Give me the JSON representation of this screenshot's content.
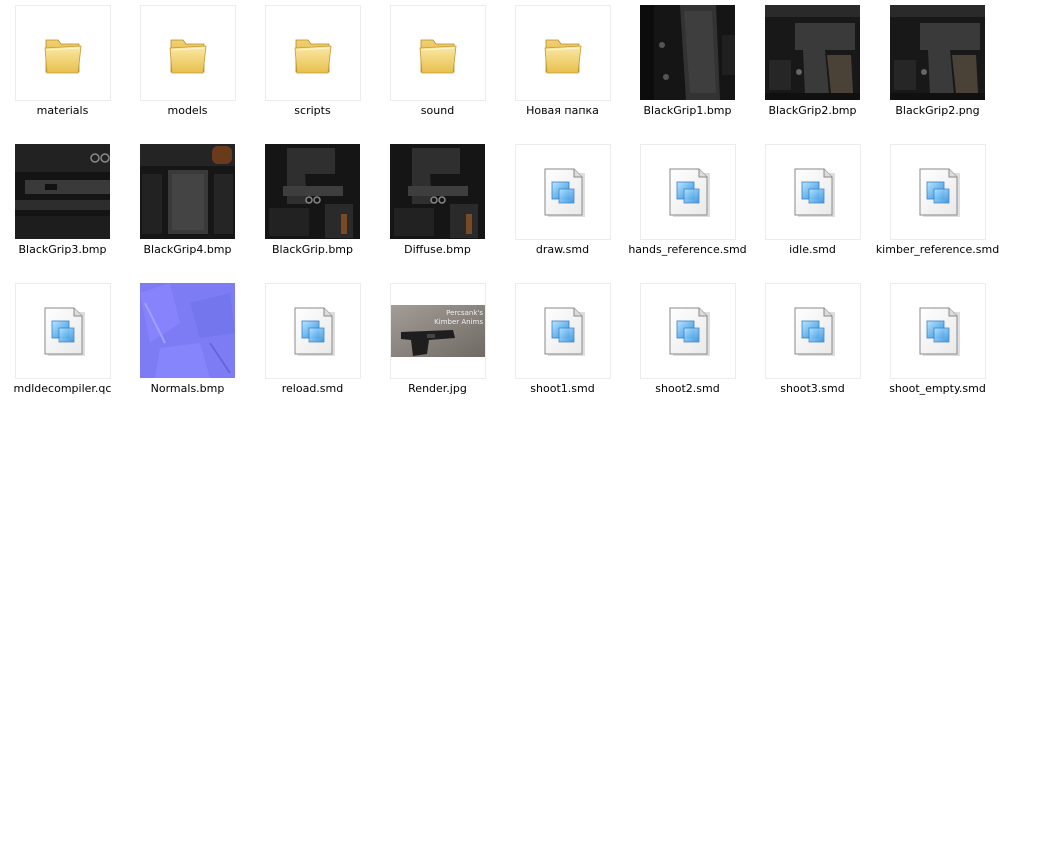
{
  "colors": {
    "background": "#ffffff",
    "thumb_border": "#ececec",
    "label_text": "#000000",
    "folder_yellow": "#f3d77a",
    "texture_dark": "#1e1e1e",
    "normal_map_blue": "#7d7cf4",
    "render_gray": "#8b847f"
  },
  "items": [
    {
      "name": "materials",
      "kind": "folder",
      "icon": "folder-icon"
    },
    {
      "name": "models",
      "kind": "folder",
      "icon": "folder-icon"
    },
    {
      "name": "scripts",
      "kind": "folder",
      "icon": "folder-icon"
    },
    {
      "name": "sound",
      "kind": "folder",
      "icon": "folder-icon"
    },
    {
      "name": "Новая папка",
      "kind": "folder",
      "icon": "folder-icon"
    },
    {
      "name": "BlackGrip1.bmp",
      "kind": "texture",
      "icon": "gun-grip-thumbnail"
    },
    {
      "name": "BlackGrip2.bmp",
      "kind": "texture",
      "icon": "gun-slide-thumbnail"
    },
    {
      "name": "BlackGrip2.png",
      "kind": "texture",
      "icon": "gun-slide-thumbnail"
    },
    {
      "name": "BlackGrip3.bmp",
      "kind": "texture",
      "icon": "gun-barrel-thumbnail"
    },
    {
      "name": "BlackGrip4.bmp",
      "kind": "texture",
      "icon": "gun-magazine-thumbnail"
    },
    {
      "name": "BlackGrip.bmp",
      "kind": "texture",
      "icon": "gun-parts-thumbnail"
    },
    {
      "name": "Diffuse.bmp",
      "kind": "texture",
      "icon": "gun-parts-thumbnail"
    },
    {
      "name": "draw.smd",
      "kind": "document",
      "icon": "document-icon"
    },
    {
      "name": "hands_reference.smd",
      "kind": "document",
      "icon": "document-icon"
    },
    {
      "name": "idle.smd",
      "kind": "document",
      "icon": "document-icon"
    },
    {
      "name": "kimber_reference.smd",
      "kind": "document",
      "icon": "document-icon"
    },
    {
      "name": "mdldecompiler.qc",
      "kind": "document",
      "icon": "document-icon"
    },
    {
      "name": "Normals.bmp",
      "kind": "normals",
      "icon": "normal-map-thumbnail"
    },
    {
      "name": "reload.smd",
      "kind": "document",
      "icon": "document-icon"
    },
    {
      "name": "Render.jpg",
      "kind": "render",
      "icon": "pistol-render-thumbnail",
      "caption": [
        "Percsank's",
        "Kimber Anims"
      ]
    },
    {
      "name": "shoot1.smd",
      "kind": "document",
      "icon": "document-icon"
    },
    {
      "name": "shoot2.smd",
      "kind": "document",
      "icon": "document-icon"
    },
    {
      "name": "shoot3.smd",
      "kind": "document",
      "icon": "document-icon"
    },
    {
      "name": "shoot_empty.smd",
      "kind": "document",
      "icon": "document-icon"
    }
  ]
}
